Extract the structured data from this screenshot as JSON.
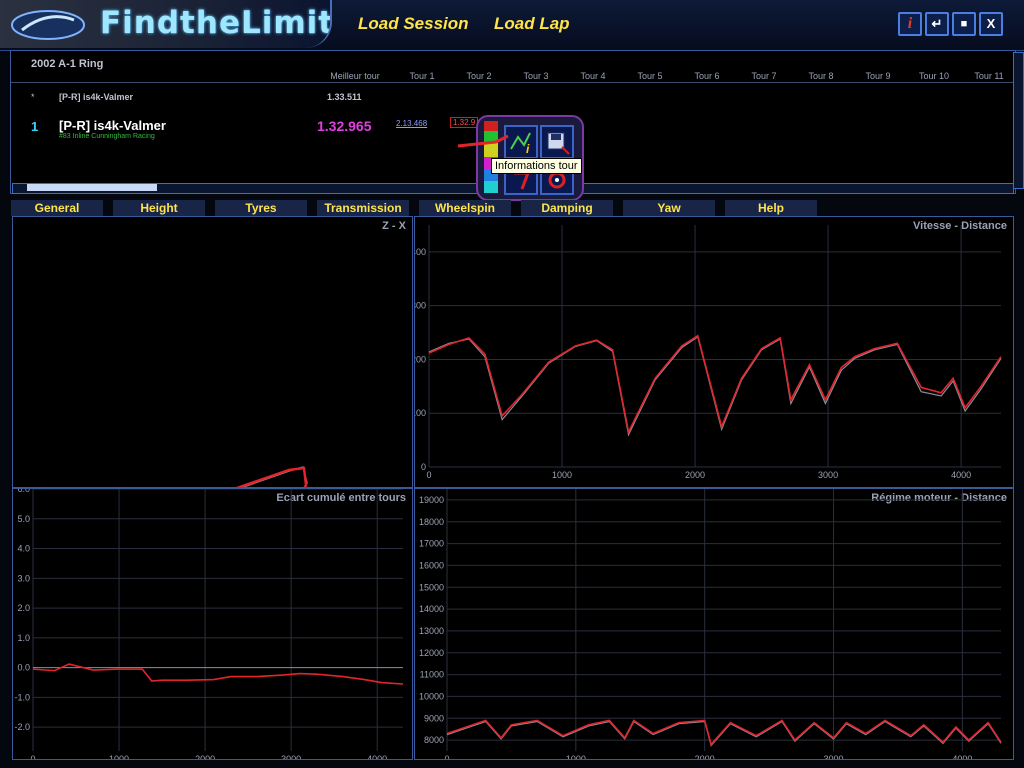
{
  "header": {
    "logo_text": "FindtheLimit",
    "menu": [
      {
        "label": "Load Session"
      },
      {
        "label": "Load Lap"
      }
    ],
    "window_buttons": [
      {
        "icon": "info-icon",
        "glyph": "i",
        "color": "#e0402a"
      },
      {
        "icon": "enter-icon",
        "glyph": "↵"
      },
      {
        "icon": "maximize-icon",
        "glyph": "■"
      },
      {
        "icon": "close-icon",
        "glyph": "X"
      }
    ]
  },
  "session": {
    "title": "2002 A-1 Ring",
    "columns": [
      "Meilleur tour",
      "Tour 1",
      "Tour 2",
      "Tour 3",
      "Tour 4",
      "Tour 5",
      "Tour 6",
      "Tour 7",
      "Tour 8",
      "Tour 9",
      "Tour 10",
      "Tour 11"
    ],
    "reference_row": {
      "marker": "*",
      "driver": "[P-R] is4k-Valmer",
      "best": "1.33.511"
    },
    "driver_row": {
      "position": "1",
      "driver": "[P-R] is4k-Valmer",
      "team": "#83 Inline Cunningham Racing",
      "best": "1.32.965",
      "lap1": "2.13.468",
      "lap2": "1.32.9"
    },
    "popup_tooltip": "Informations tour",
    "popup_icons": [
      "lap-info-icon",
      "save-icon",
      "delete-icon",
      "target-icon"
    ]
  },
  "tabs": [
    {
      "label": "General"
    },
    {
      "label": "Height"
    },
    {
      "label": "Tyres"
    },
    {
      "label": "Transmission"
    },
    {
      "label": "Wheelspin"
    },
    {
      "label": "Damping"
    },
    {
      "label": "Yaw"
    },
    {
      "label": "Help"
    }
  ],
  "colors": {
    "lap_red": "#e3242b",
    "lap_ref": "#8a8f9a",
    "accent": "#ffe44a",
    "best": "#e040e0"
  },
  "chart_data": [
    {
      "type": "line",
      "title": "Z - X",
      "description_only": false,
      "series": [
        {
          "name": "",
          "values": []
        }
      ]
    },
    {
      "type": "line",
      "title": "Vitesse - Distance",
      "xlim": [
        0,
        4300
      ],
      "ylim": [
        0,
        450
      ],
      "x_ticks": [
        0,
        1000,
        2000,
        3000,
        4000
      ],
      "y_ticks": [
        0,
        100,
        200,
        300,
        400
      ],
      "x": [
        0,
        150,
        300,
        420,
        550,
        700,
        900,
        1100,
        1260,
        1380,
        1500,
        1700,
        1900,
        2020,
        2200,
        2350,
        2500,
        2640,
        2720,
        2860,
        2980,
        3100,
        3200,
        3350,
        3520,
        3700,
        3850,
        3940,
        4030,
        4150,
        4300
      ],
      "series": [
        {
          "name": "",
          "values": [
            212,
            228,
            240,
            210,
            95,
            135,
            195,
            225,
            236,
            218,
            65,
            165,
            225,
            244,
            75,
            165,
            220,
            240,
            125,
            190,
            125,
            185,
            205,
            220,
            230,
            148,
            138,
            165,
            110,
            150,
            205
          ]
        },
        {
          "name": "",
          "values": [
            214,
            230,
            238,
            205,
            88,
            132,
            193,
            224,
            235,
            215,
            60,
            162,
            222,
            242,
            70,
            162,
            218,
            238,
            118,
            186,
            118,
            180,
            202,
            218,
            228,
            140,
            132,
            160,
            104,
            145,
            202
          ]
        }
      ]
    },
    {
      "type": "line",
      "title": "Ecart cumulé entre tours",
      "xlim": [
        0,
        4300
      ],
      "ylim": [
        -2.8,
        6.0
      ],
      "x_ticks": [
        0,
        1000,
        2000,
        3000,
        4000
      ],
      "y_ticks": [
        6.0,
        5.0,
        4.0,
        3.0,
        2.0,
        1.0,
        0.0,
        -1.0,
        -2.0
      ],
      "x": [
        0,
        250,
        420,
        700,
        1000,
        1270,
        1380,
        1500,
        1800,
        2100,
        2300,
        2600,
        2900,
        3100,
        3300,
        3600,
        3850,
        4050,
        4300
      ],
      "series": [
        {
          "name": "",
          "values": [
            -0.05,
            -0.1,
            0.12,
            -0.08,
            -0.05,
            -0.05,
            -0.45,
            -0.42,
            -0.42,
            -0.4,
            -0.3,
            -0.3,
            -0.25,
            -0.2,
            -0.22,
            -0.3,
            -0.4,
            -0.5,
            -0.55
          ]
        }
      ]
    },
    {
      "type": "line",
      "title": "Régime moteur - Distance",
      "xlim": [
        0,
        4300
      ],
      "ylim": [
        7500,
        19500
      ],
      "x_ticks": [
        0,
        1000,
        2000,
        3000,
        4000
      ],
      "y_ticks": [
        8000,
        9000,
        10000,
        11000,
        12000,
        13000,
        14000,
        15000,
        16000,
        17000,
        18000,
        19000
      ],
      "x": [
        0,
        150,
        300,
        420,
        500,
        700,
        900,
        1100,
        1260,
        1380,
        1450,
        1600,
        1800,
        2000,
        2050,
        2200,
        2400,
        2600,
        2700,
        2850,
        3000,
        3100,
        3250,
        3400,
        3600,
        3700,
        3850,
        3950,
        4050,
        4200,
        4300
      ],
      "series": [
        {
          "name": "",
          "values": [
            8300,
            8600,
            8900,
            8100,
            8700,
            8900,
            8200,
            8700,
            8900,
            8100,
            8900,
            8300,
            8800,
            8900,
            7800,
            8800,
            8200,
            8900,
            8000,
            8800,
            8100,
            8800,
            8300,
            8900,
            8200,
            8700,
            7900,
            8600,
            8000,
            8800,
            7900
          ]
        },
        {
          "name": "",
          "values": [
            8250,
            8550,
            8850,
            8050,
            8650,
            8850,
            8150,
            8650,
            8850,
            8050,
            8850,
            8250,
            8750,
            8850,
            7750,
            8750,
            8150,
            8850,
            7950,
            8750,
            8050,
            8750,
            8250,
            8850,
            8150,
            8650,
            7850,
            8550,
            7950,
            8750,
            7850
          ]
        }
      ]
    }
  ]
}
